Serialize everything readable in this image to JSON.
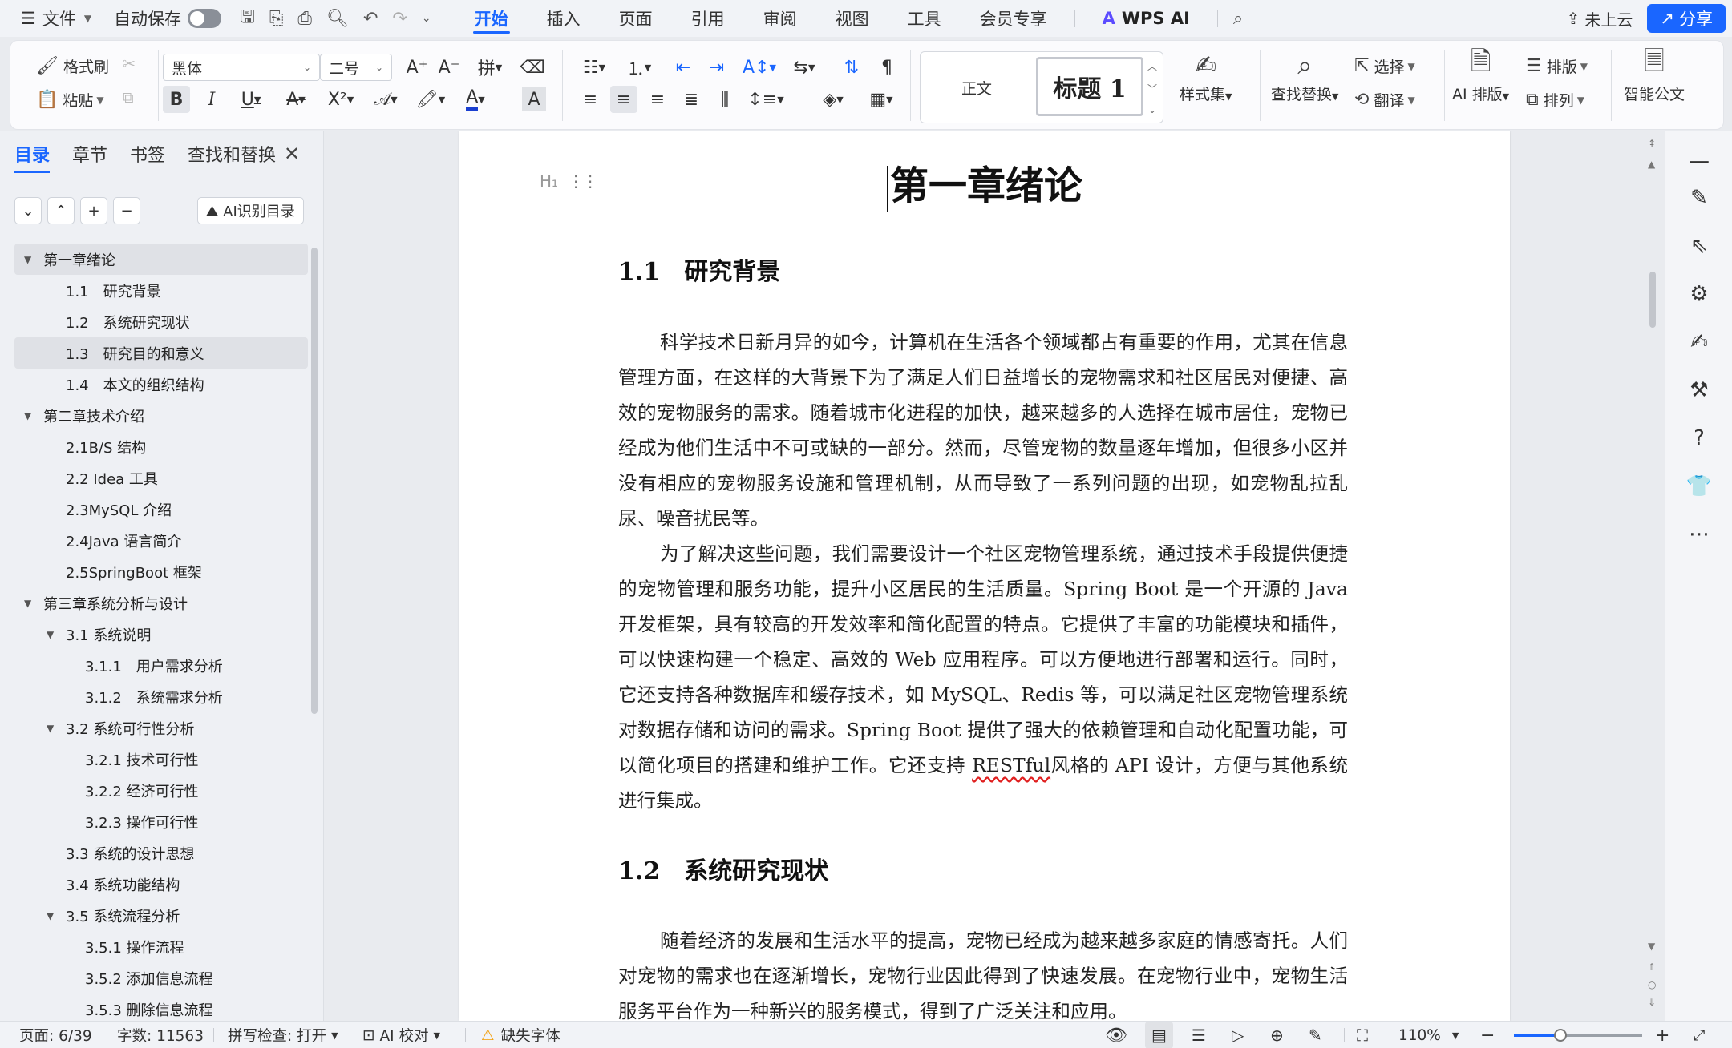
{
  "menubar": {
    "file": "文件",
    "autosave": "自动保存",
    "tabs": [
      "开始",
      "插入",
      "页面",
      "引用",
      "审阅",
      "视图",
      "工具",
      "会员专享"
    ],
    "wps_ai": "WPS AI",
    "cloud": "未上云",
    "share": "分享"
  },
  "ribbon": {
    "format_painter": "格式刷",
    "paste": "粘贴",
    "font_name": "黑体",
    "font_size": "二号",
    "style_normal": "正文",
    "style_heading": "标题 1",
    "style_set": "样式集",
    "find_replace": "查找替换",
    "select": "选择",
    "translate": "翻译",
    "ai_layout": "AI 排版",
    "layout": "排版",
    "arrange": "排列",
    "smart_doc": "智能公文"
  },
  "nav": {
    "tabs": [
      "目录",
      "章节",
      "书签",
      "查找和替换"
    ],
    "ai_toc": "AI识别目录",
    "toc": [
      {
        "text": "第一章绪论",
        "level": 0,
        "arrow": true,
        "selected": true
      },
      {
        "text": "1.1　研究背景",
        "level": 1
      },
      {
        "text": "1.2　系统研究现状",
        "level": 1
      },
      {
        "text": "1.3　研究目的和意义",
        "level": 1,
        "selected": true
      },
      {
        "text": "1.4　本文的组织结构",
        "level": 1
      },
      {
        "text": "第二章技术介绍",
        "level": 0,
        "arrow": true
      },
      {
        "text": "2.1B/S 结构",
        "level": 1
      },
      {
        "text": "2.2 Idea 工具",
        "level": 1
      },
      {
        "text": "2.3MySQL 介绍",
        "level": 1
      },
      {
        "text": "2.4Java 语言简介",
        "level": 1
      },
      {
        "text": "2.5SpringBoot 框架",
        "level": 1
      },
      {
        "text": "第三章系统分析与设计",
        "level": 0,
        "arrow": true
      },
      {
        "text": "3.1 系统说明",
        "level": 1,
        "arrow": true
      },
      {
        "text": "3.1.1　用户需求分析",
        "level": 2
      },
      {
        "text": "3.1.2　系统需求分析",
        "level": 2
      },
      {
        "text": "3.2 系统可行性分析",
        "level": 1,
        "arrow": true
      },
      {
        "text": "3.2.1  技术可行性",
        "level": 2
      },
      {
        "text": "3.2.2  经济可行性",
        "level": 2
      },
      {
        "text": "3.2.3  操作可行性",
        "level": 2
      },
      {
        "text": "3.3 系统的设计思想",
        "level": 1
      },
      {
        "text": "3.4 系统功能结构",
        "level": 1
      },
      {
        "text": "3.5 系统流程分析",
        "level": 1,
        "arrow": true
      },
      {
        "text": "3.5.1 操作流程",
        "level": 2
      },
      {
        "text": "3.5.2 添加信息流程",
        "level": 2
      },
      {
        "text": "3.5.3 删除信息流程",
        "level": 2
      }
    ]
  },
  "doc": {
    "title": "第一章绪论",
    "h_1_1": "1.1　研究背景",
    "p1": "科学技术日新月异的如今，计算机在生活各个领域都占有重要的作用，尤其在信息管理方面，在这样的大背景下为了满足人们日益增长的宠物需求和社区居民对便捷、高效的宠物服务的需求。随着城市化进程的加快，越来越多的人选择在城市居住，宠物已经成为他们生活中不可或缺的一部分。然而，尽管宠物的数量逐年增加，但很多小区并没有相应的宠物服务设施和管理机制，从而导致了一系列问题的出现，如宠物乱拉乱尿、噪音扰民等。",
    "p2_before": "为了解决这些问题，我们需要设计一个社区宠物管理系统，通过技术手段提供便捷的宠物管理和服务功能，提升小区居民的生活质量。Spring Boot 是一个开源的 Java 开发框架，具有较高的开发效率和简化配置的特点。它提供了丰富的功能模块和插件，可以快速构建一个稳定、高效的 Web 应用程序。可以方便地进行部署和运行。同时，它还支持各种数据库和缓存技术，如 MySQL、Redis 等，可以满足社区宠物管理系统对数据存储和访问的需求。Spring Boot 提供了强大的依赖管理和自动化配置功能，可以简化项目的搭建和维护工作。它还支持 ",
    "p2_flag": "RESTful",
    "p2_after": "风格的 API 设计，方便与其他系统进行集成。",
    "h_1_2": "1.2　系统研究现状",
    "p3": "随着经济的发展和生活水平的提高，宠物已经成为越来越多家庭的情感寄托。人们对宠物的需求也在逐渐增长，宠物行业因此得到了快速发展。在宠物行业中，宠物生活服务平台作为一种新兴的服务模式，得到了广泛关注和应用。"
  },
  "status": {
    "page": "页面: 6/39",
    "words": "字数: 11563",
    "spell": "拼写检查: 打开",
    "ai_proof": "AI 校对",
    "missing_font": "缺失字体",
    "zoom": "110%",
    "zoom_fraction": 0.36
  },
  "colors": {
    "accent": "#1a66ff",
    "wps_ai_logo": "#5b4bff",
    "warning": "#f29b00",
    "spell_error": "#e02020"
  }
}
